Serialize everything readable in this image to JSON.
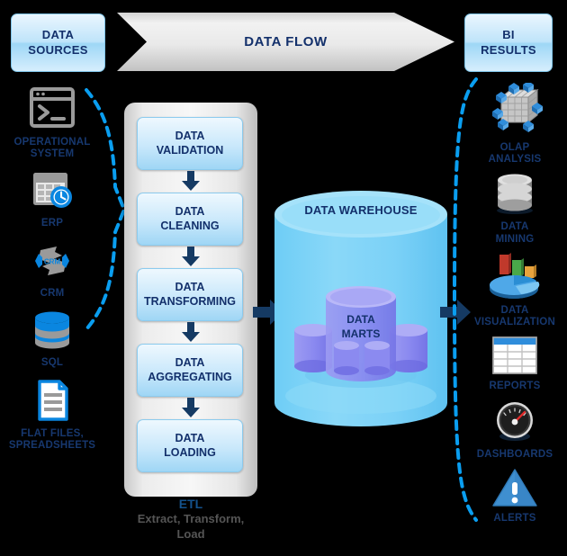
{
  "header": {
    "sources_label": "DATA\nSOURCES",
    "sources_line1": "DATA",
    "sources_line2": "SOURCES",
    "flow_label": "DATA FLOW",
    "results_line1": "BI",
    "results_line2": "RESULTS"
  },
  "colors": {
    "accent_blue": "#0a86e0",
    "dark_navy": "#13306b",
    "arrow_navy": "#153a63",
    "warehouse_cyan": "#7dd2f7",
    "mart_purple": "#8f8ef0",
    "gray_icon": "#9a9a9a",
    "etl_label_blue": "#14528c",
    "background": "#000000"
  },
  "data_sources": [
    {
      "id": "operational-system",
      "icon": "terminal-window-icon",
      "label": "OPERATIONAL\nSYSTEM",
      "line1": "OPERATIONAL",
      "line2": "SYSTEM"
    },
    {
      "id": "erp",
      "icon": "calendar-clock-icon",
      "label": "ERP",
      "line1": "ERP",
      "line2": ""
    },
    {
      "id": "crm",
      "icon": "crm-cycle-icon",
      "label": "CRM",
      "line1": "CRM",
      "line2": ""
    },
    {
      "id": "sql",
      "icon": "database-cylinder-icon",
      "label": "SQL",
      "line1": "SQL",
      "line2": ""
    },
    {
      "id": "flat-files",
      "icon": "document-lines-icon",
      "label": "FLAT FILES,\nSPREADSHEETS",
      "line1": "FLAT FILES,",
      "line2": "SPREADSHEETS"
    }
  ],
  "etl": {
    "steps": [
      {
        "id": "data-validation",
        "line1": "DATA",
        "line2": "VALIDATION"
      },
      {
        "id": "data-cleaning",
        "line1": "DATA",
        "line2": "CLEANING"
      },
      {
        "id": "data-transforming",
        "line1": "DATA",
        "line2": "TRANSFORMING"
      },
      {
        "id": "data-aggregating",
        "line1": "DATA",
        "line2": "AGGREGATING"
      },
      {
        "id": "data-loading",
        "line1": "DATA",
        "line2": "LOADING"
      }
    ],
    "caption_title": "ETL",
    "caption_sub_line1": "Extract, Transform,",
    "caption_sub_line2": "Load"
  },
  "warehouse": {
    "title": "DATA WAREHOUSE",
    "marts_line1": "DATA",
    "marts_line2": "MARTS"
  },
  "bi_results": [
    {
      "id": "olap-analysis",
      "icon": "olap-cube-icon",
      "label": "OLAP\nANALYSIS",
      "line1": "OLAP",
      "line2": "ANALYSIS"
    },
    {
      "id": "data-mining",
      "icon": "metal-database-icon",
      "label": "DATA\nMINING",
      "line1": "DATA",
      "line2": "MINING"
    },
    {
      "id": "data-visualization",
      "icon": "pie-bar-chart-icon",
      "label": "DATA\nVISUALIZATION",
      "line1": "DATA",
      "line2": "VISUALIZATION"
    },
    {
      "id": "reports",
      "icon": "table-grid-icon",
      "label": "REPORTS",
      "line1": "REPORTS",
      "line2": ""
    },
    {
      "id": "dashboards",
      "icon": "gauge-icon",
      "label": "DASHBOARDS",
      "line1": "DASHBOARDS",
      "line2": ""
    },
    {
      "id": "alerts",
      "icon": "warning-triangle-icon",
      "label": "ALERTS",
      "line1": "ALERTS",
      "line2": ""
    }
  ]
}
